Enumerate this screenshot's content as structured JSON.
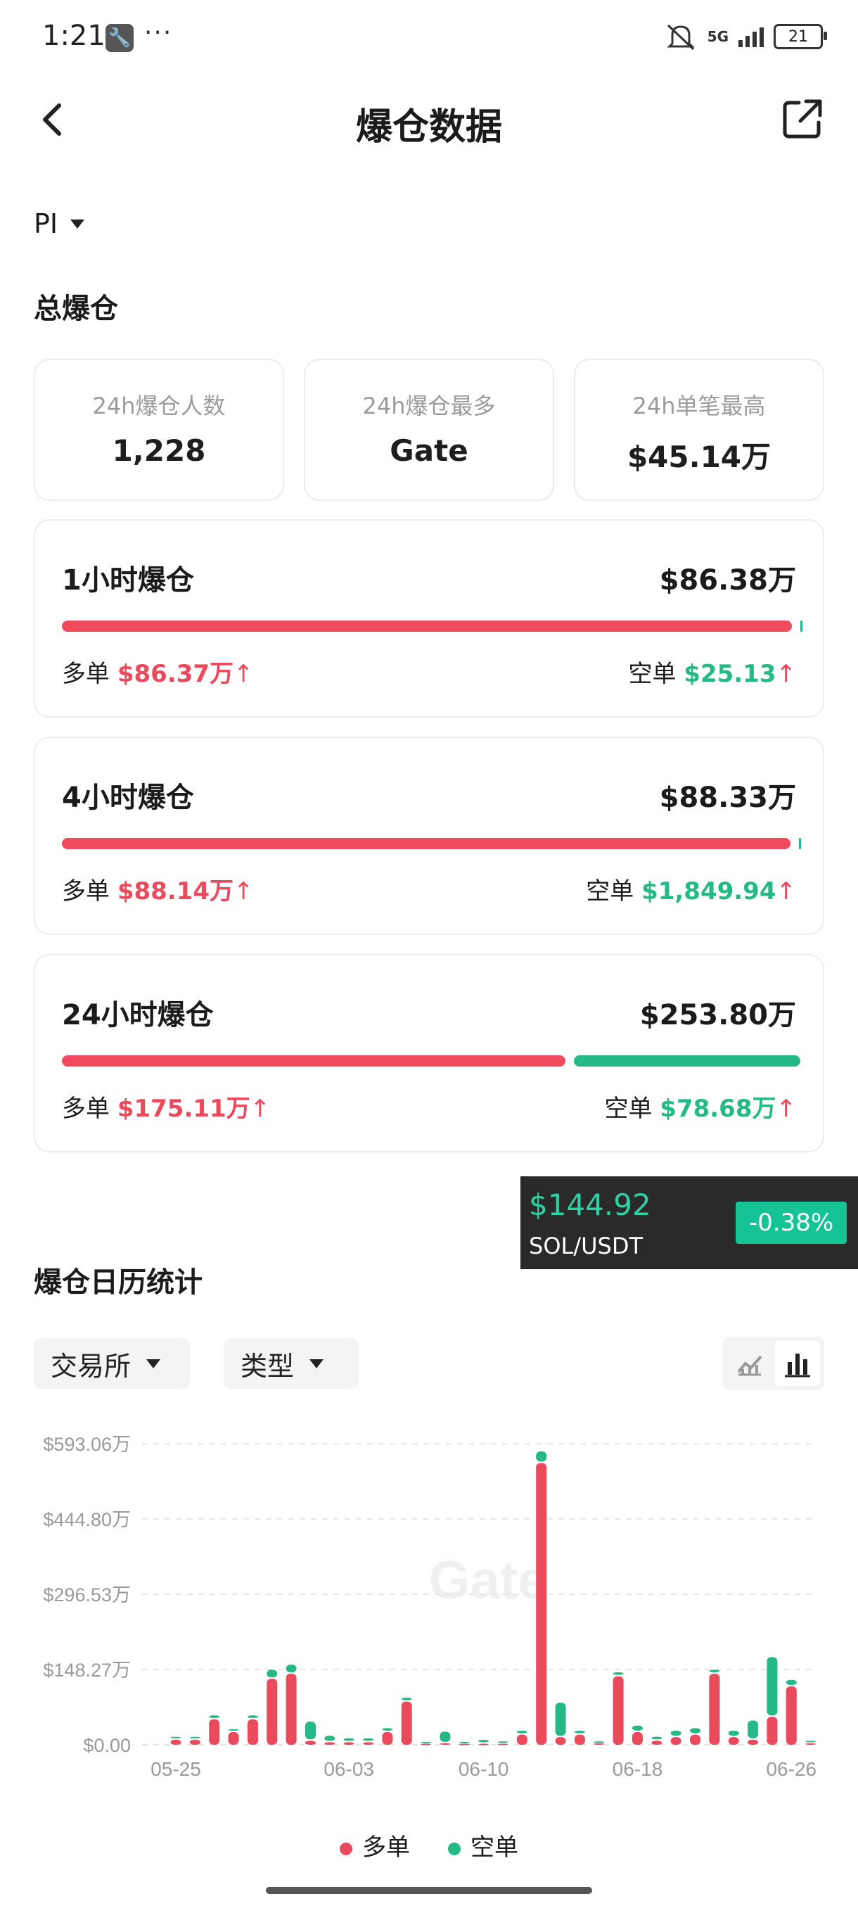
{
  "status_bar": {
    "time": "1:21",
    "dots": "···",
    "network": "5G",
    "battery": "21"
  },
  "header": {
    "title": "爆仓数据"
  },
  "symbol": "PI",
  "section_total": "总爆仓",
  "stats": [
    {
      "label": "24h爆仓人数",
      "value": "1,228"
    },
    {
      "label": "24h爆仓最多",
      "value": "Gate"
    },
    {
      "label": "24h单笔最高",
      "value": "$45.14万"
    }
  ],
  "liquidations": [
    {
      "name": "1小时爆仓",
      "total": "$86.38万",
      "long_label": "多单",
      "long_value": "$86.37万",
      "short_label": "空单",
      "short_value": "$25.13",
      "long_share": 0.99997
    },
    {
      "name": "4小时爆仓",
      "total": "$88.33万",
      "long_label": "多单",
      "long_value": "$88.14万",
      "short_label": "空单",
      "short_value": "$1,849.94",
      "long_share": 0.9979
    },
    {
      "name": "24小时爆仓",
      "total": "$253.80万",
      "long_label": "多单",
      "long_value": "$175.11万",
      "short_label": "空单",
      "short_value": "$78.68万",
      "long_share": 0.69
    }
  ],
  "arrow": "↑",
  "float_ticker": {
    "price": "$144.92",
    "pair": "SOL/USDT",
    "change": "-0.38%"
  },
  "section_calendar": "爆仓日历统计",
  "filters": {
    "exchange": "交易所",
    "type": "类型"
  },
  "colors": {
    "long": "#e94b5d",
    "short": "#25b986"
  },
  "icons": {
    "back": "chevron-left-icon",
    "share": "share-icon",
    "line_chart": "line-chart-icon",
    "bar_chart": "bar-chart-icon"
  },
  "chart_data": {
    "type": "bar",
    "stacked": true,
    "watermark": "Gate",
    "y_ticks": [
      "$0.00",
      "$148.27万",
      "$296.53万",
      "$444.80万",
      "$593.06万"
    ],
    "ylim": [
      0,
      593.06
    ],
    "x_ticks": [
      {
        "label": "05-25",
        "index": 0
      },
      {
        "label": "06-03",
        "index": 9
      },
      {
        "label": "06-10",
        "index": 16
      },
      {
        "label": "06-18",
        "index": 24
      },
      {
        "label": "06-26",
        "index": 32
      }
    ],
    "categories": [
      "05-25",
      "05-26",
      "05-27",
      "05-28",
      "05-29",
      "05-30",
      "05-31",
      "06-01",
      "06-02",
      "06-03",
      "06-04",
      "06-05",
      "06-06",
      "06-07",
      "06-08",
      "06-09",
      "06-10",
      "06-11",
      "06-12",
      "06-13",
      "06-14",
      "06-15",
      "06-16",
      "06-17",
      "06-18",
      "06-19",
      "06-20",
      "06-21",
      "06-22",
      "06-23",
      "06-24",
      "06-25",
      "06-26",
      "06-27"
    ],
    "series": [
      {
        "name": "多单",
        "values": [
          10,
          10,
          50,
          25,
          50,
          130,
          140,
          8,
          5,
          5,
          5,
          25,
          85,
          2,
          3,
          2,
          2,
          2,
          20,
          555,
          15,
          20,
          3,
          135,
          25,
          8,
          15,
          20,
          140,
          15,
          10,
          55,
          115,
          3
        ]
      },
      {
        "name": "空单",
        "values": [
          3,
          3,
          5,
          3,
          5,
          15,
          15,
          35,
          10,
          5,
          5,
          5,
          5,
          1,
          20,
          1,
          5,
          2,
          5,
          20,
          65,
          5,
          1,
          5,
          10,
          5,
          10,
          10,
          5,
          10,
          35,
          115,
          10,
          2
        ]
      }
    ]
  },
  "legend": {
    "long": "多单",
    "short": "空单"
  }
}
